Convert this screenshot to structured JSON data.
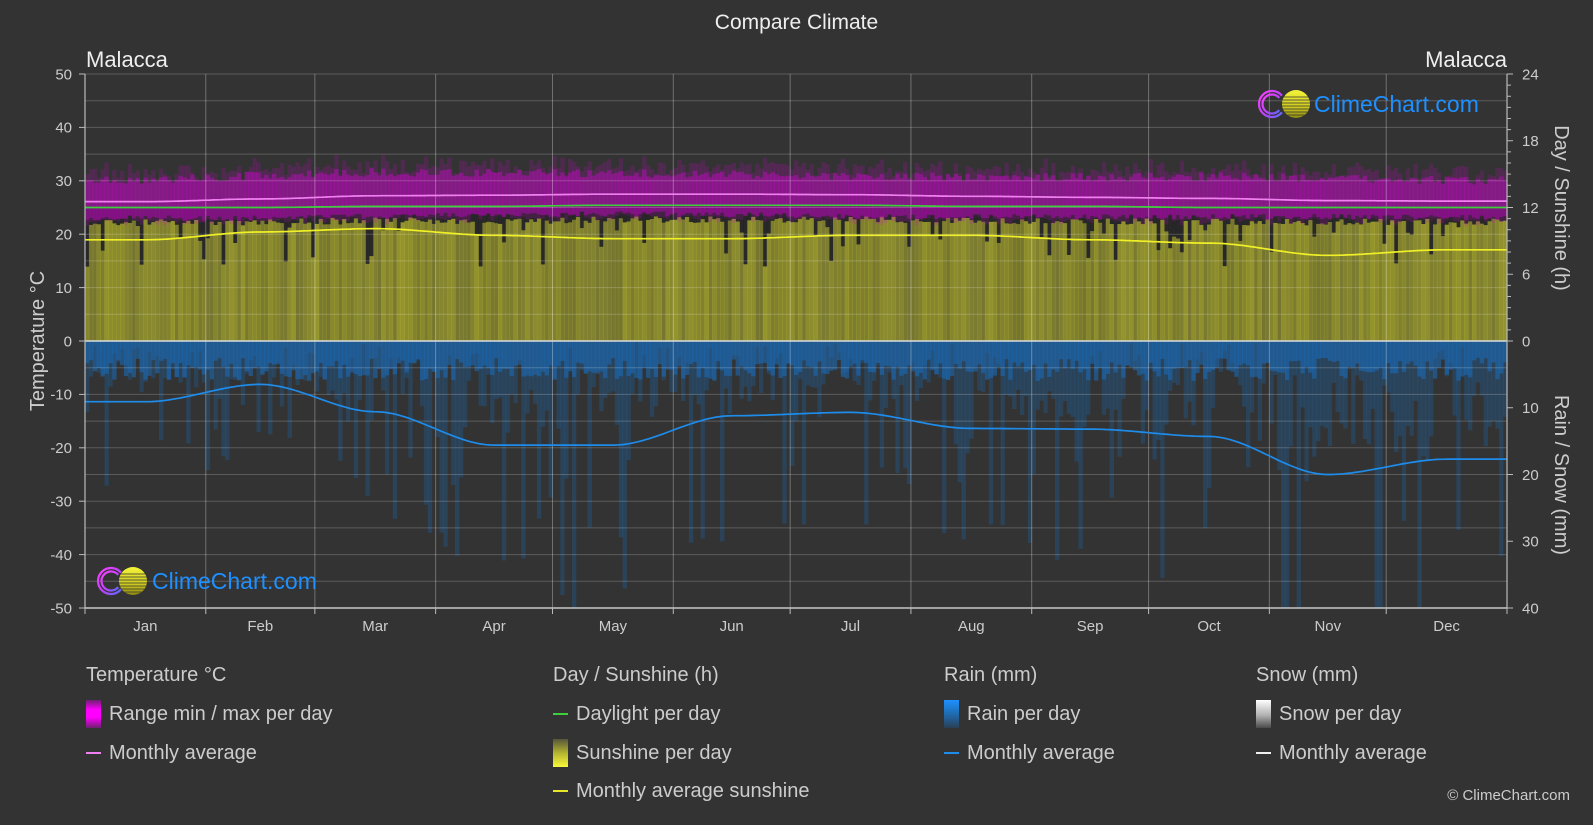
{
  "page": {
    "title": "Compare Climate"
  },
  "locations": {
    "left": "Malacca",
    "right": "Malacca"
  },
  "watermark": {
    "text": "ClimeChart.com",
    "color": "#1e90ff"
  },
  "legend": {
    "groups": [
      {
        "title": "Temperature °C",
        "items": [
          {
            "label": "Range min / max per day",
            "icon": "magenta-gradient-bar",
            "color": "#ff00ff"
          },
          {
            "label": "Monthly average",
            "icon": "line-dash",
            "color": "#f080f0"
          }
        ]
      },
      {
        "title": "Day / Sunshine (h)",
        "items": [
          {
            "label": "Daylight per day",
            "icon": "line-dash",
            "color": "#3ccf3c"
          },
          {
            "label": "Sunshine per day",
            "icon": "yellow-gradient-bar",
            "color": "#f0f030"
          },
          {
            "label": "Monthly average sunshine",
            "icon": "line-dash",
            "color": "#e8e828"
          }
        ]
      },
      {
        "title": "Rain (mm)",
        "items": [
          {
            "label": "Rain per day",
            "icon": "blue-gradient-bar",
            "color": "#1e90ff"
          },
          {
            "label": "Monthly average",
            "icon": "line-dash",
            "color": "#1e8ceb"
          }
        ]
      },
      {
        "title": "Snow (mm)",
        "items": [
          {
            "label": "Snow per day",
            "icon": "white-gradient-bar",
            "color": "#ffffff"
          },
          {
            "label": "Monthly average",
            "icon": "line-dash",
            "color": "#f0f0f0"
          }
        ]
      }
    ]
  },
  "copyright": "© ClimeChart.com",
  "chart_data": {
    "type": "line",
    "title": "Compare Climate",
    "subtitle_left": "Malacca",
    "subtitle_right": "Malacca",
    "categories": [
      "Jan",
      "Feb",
      "Mar",
      "Apr",
      "May",
      "Jun",
      "Jul",
      "Aug",
      "Sep",
      "Oct",
      "Nov",
      "Dec"
    ],
    "xlabel": "",
    "axes": {
      "y_left": {
        "label": "Temperature °C",
        "range": [
          -50,
          50
        ],
        "ticks": [
          50,
          40,
          30,
          20,
          10,
          0,
          -10,
          -20,
          -30,
          -40,
          -50
        ],
        "grid_step": 5
      },
      "y_right_top": {
        "label": "Day / Sunshine (h)",
        "range": [
          0,
          24
        ],
        "ticks": [
          24,
          18,
          12,
          6,
          0
        ],
        "minor_step": 1
      },
      "y_right_bottom": {
        "label": "Rain / Snow (mm)",
        "range": [
          0,
          40
        ],
        "ticks": [
          0,
          10,
          20,
          30,
          40
        ],
        "direction": "downward"
      }
    },
    "grid": true,
    "legend_position": "bottom",
    "series": [
      {
        "id": "temp_max",
        "name": "Temperature range max per day (approx.)",
        "axis": "y_left",
        "unit": "°C",
        "style": "band-upper",
        "color": "#e000e0",
        "values": [
          30.2,
          30.9,
          31.6,
          31.5,
          31.4,
          31.1,
          30.9,
          30.8,
          30.7,
          30.8,
          30.5,
          30.1
        ]
      },
      {
        "id": "temp_min",
        "name": "Temperature range min per day (approx.)",
        "axis": "y_left",
        "unit": "°C",
        "style": "band-lower",
        "color": "#e000e0",
        "values": [
          23.0,
          23.0,
          23.3,
          23.6,
          23.8,
          23.6,
          23.3,
          23.3,
          23.2,
          23.3,
          23.3,
          23.1
        ]
      },
      {
        "id": "snow_avg",
        "name": "Snow monthly average",
        "axis": "y_right_bottom",
        "unit": "mm",
        "style": "line",
        "color": "#dcdcdc",
        "values": [
          0,
          0,
          0,
          0,
          0,
          0,
          0,
          0,
          0,
          0,
          0,
          0
        ]
      },
      {
        "id": "rain_avg",
        "name": "Rain monthly average",
        "axis": "y_right_bottom",
        "unit": "mm",
        "style": "line",
        "color": "#1e8ceb",
        "values": [
          9.1,
          6.5,
          10.6,
          15.6,
          15.6,
          11.2,
          10.7,
          13.1,
          13.2,
          14.3,
          20.0,
          17.7
        ]
      },
      {
        "id": "sunshine_avg",
        "name": "Monthly average sunshine",
        "axis": "y_right_top",
        "unit": "h",
        "style": "line",
        "color": "#f0f028",
        "values": [
          9.1,
          9.8,
          10.1,
          9.5,
          9.2,
          9.2,
          9.5,
          9.5,
          9.1,
          8.8,
          7.7,
          8.2
        ]
      },
      {
        "id": "daylight",
        "name": "Daylight per day",
        "axis": "y_right_top",
        "unit": "h",
        "style": "line",
        "color": "#3ccf3c",
        "values": [
          12.0,
          12.0,
          12.1,
          12.1,
          12.2,
          12.2,
          12.2,
          12.1,
          12.1,
          12.0,
          12.0,
          12.0
        ]
      },
      {
        "id": "temp_avg",
        "name": "Temperature monthly average",
        "axis": "y_left",
        "unit": "°C",
        "style": "line",
        "color": "#f080f0",
        "values": [
          26.1,
          26.6,
          27.2,
          27.3,
          27.5,
          27.5,
          27.4,
          27.1,
          26.9,
          26.7,
          26.3,
          26.2
        ]
      }
    ]
  }
}
